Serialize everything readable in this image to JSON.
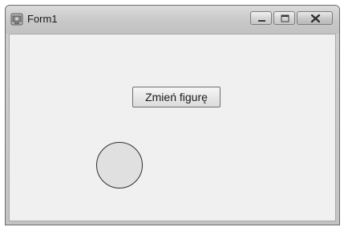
{
  "window": {
    "title": "Form1",
    "icon": "app-icon"
  },
  "caption_buttons": {
    "minimize_icon": "minimize-icon",
    "maximize_icon": "maximize-icon",
    "close_icon": "close-icon"
  },
  "content": {
    "button_label": "Zmień figurę",
    "shape": "circle",
    "shape_fill": "#e0e0e0",
    "shape_stroke": "#2f2f2f"
  }
}
